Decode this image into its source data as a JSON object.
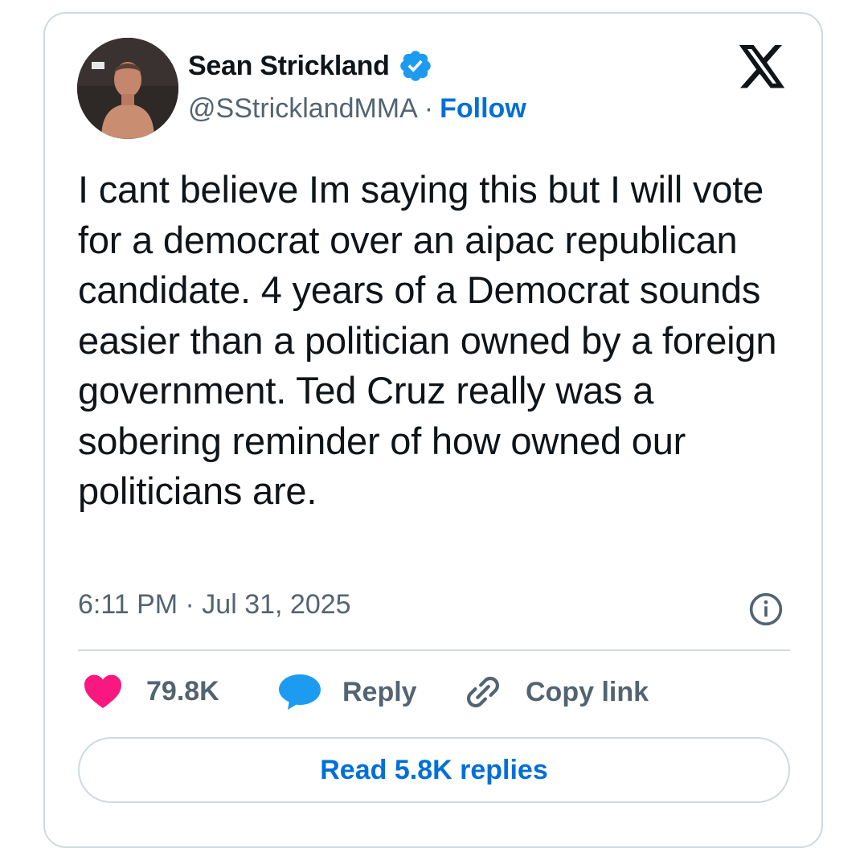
{
  "author": {
    "display_name": "Sean Strickland",
    "handle": "@SStricklandMMA",
    "separator": "·",
    "follow_label": "Follow",
    "verified": true
  },
  "tweet": {
    "text": "I cant believe Im saying this but I will vote for a democrat over an aipac republican candidate. 4 years of a Democrat sounds easier than a politician owned by a foreign government. Ted Cruz really was a sobering reminder of how owned our politicians are.",
    "timestamp": "6:11 PM · Jul 31, 2025"
  },
  "actions": {
    "like_count": "79.8K",
    "reply_label": "Reply",
    "copy_link_label": "Copy link"
  },
  "read_replies_label": "Read 5.8K replies",
  "colors": {
    "accent": "#006fd6",
    "like": "#f91880",
    "reply": "#1d9bf0",
    "muted": "#536471",
    "border": "#cfd9de"
  },
  "icons": [
    "verified-badge-icon",
    "x-logo-icon",
    "info-icon",
    "heart-icon",
    "reply-bubble-icon",
    "link-icon"
  ]
}
